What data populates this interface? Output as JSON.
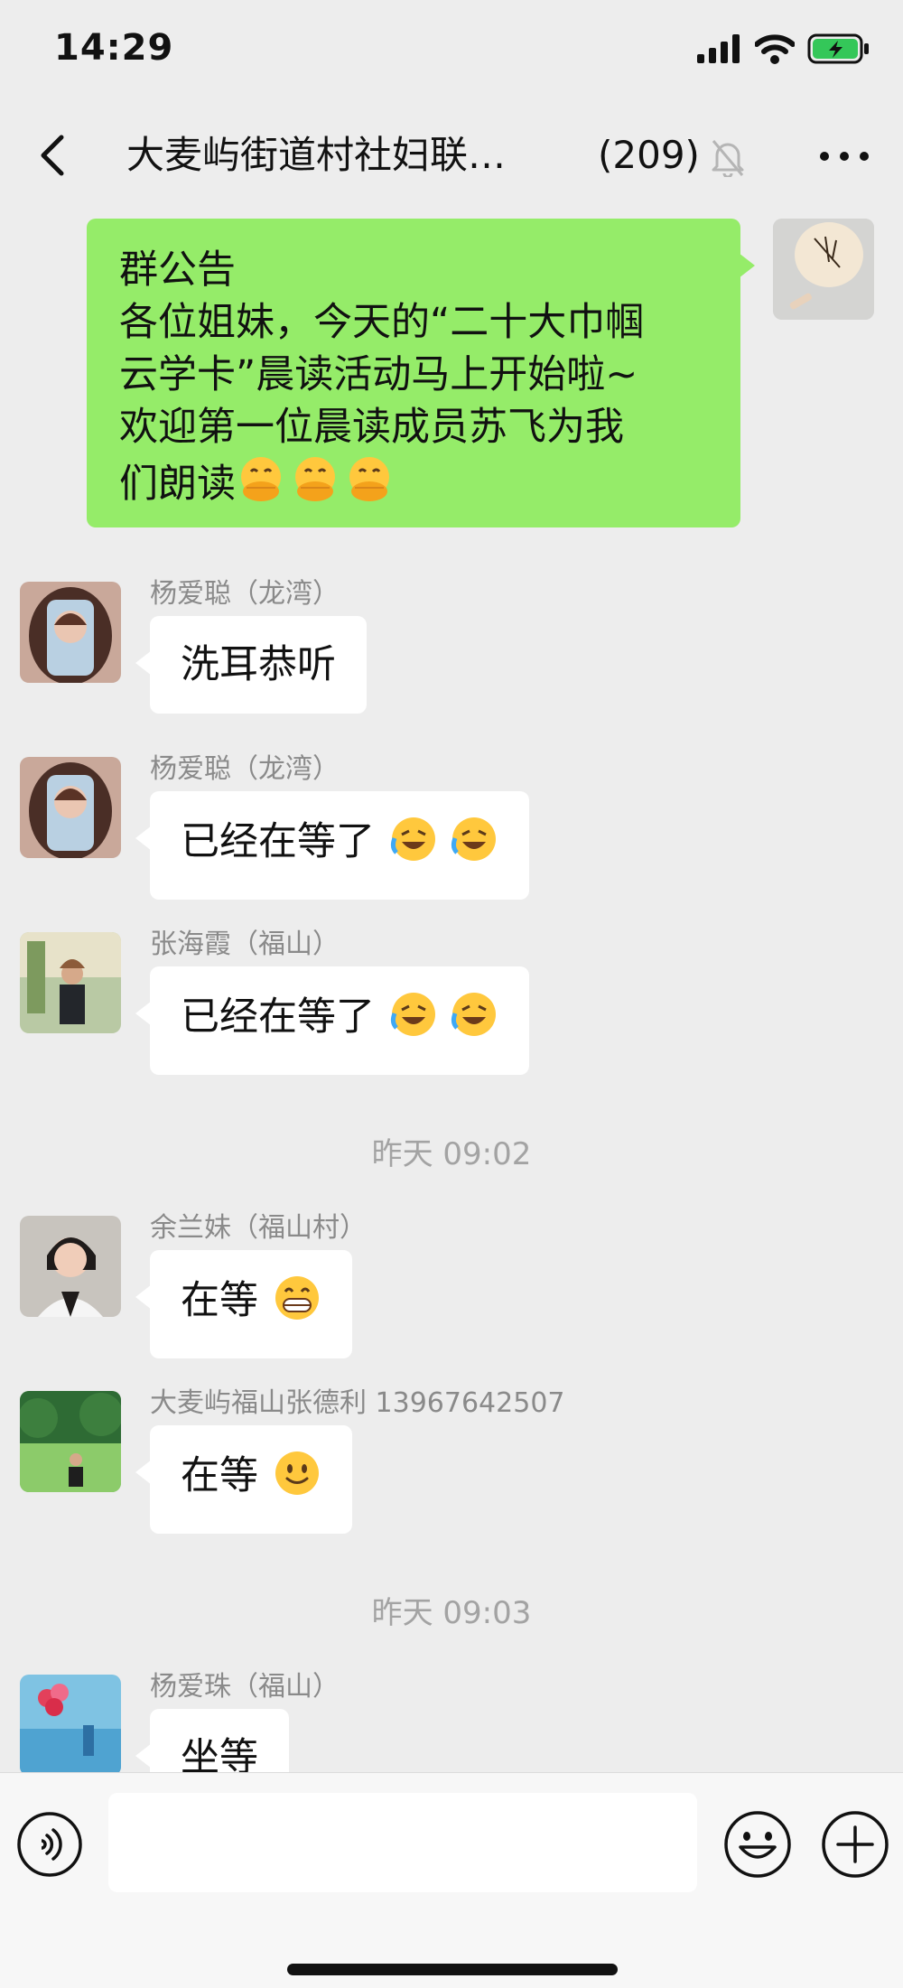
{
  "status_bar": {
    "time": "14:29"
  },
  "nav": {
    "title": "大麦屿街道村社妇联…",
    "member_count": "(209)"
  },
  "announcement": {
    "line1": "群公告",
    "line2": "各位姐妹，今天的“二十大巾帼",
    "line3": "云学卡”晨读活动马上开始啦~",
    "line4": "欢迎第一位晨读成员苏飞为我",
    "line5": "们朗读"
  },
  "messages": [
    {
      "sender": "杨爱聪（龙湾）",
      "text": "洗耳恭听"
    },
    {
      "sender": "杨爱聪（龙湾）",
      "text": "已经在等了"
    },
    {
      "sender": "张海霞（福山）",
      "text": "已经在等了"
    },
    {
      "sender": "余兰妹（福山村）",
      "text": "在等"
    },
    {
      "sender": "大麦屿福山张德利 13967642507",
      "text": "在等"
    },
    {
      "sender": "杨爱珠（福山）",
      "text": "坐等"
    }
  ],
  "timestamps": [
    "昨天 09:02",
    "昨天 09:03"
  ],
  "icons": {
    "back": "chevron-left-icon",
    "mute": "bell-slash-icon",
    "more": "more-dots-icon",
    "voice": "voice-icon",
    "emoji": "smiley-icon",
    "plus": "plus-circle-icon"
  },
  "colors": {
    "self_bubble": "#95EC69",
    "other_bubble": "#FFFFFF",
    "background": "#EDEDED",
    "battery": "#34C759"
  }
}
